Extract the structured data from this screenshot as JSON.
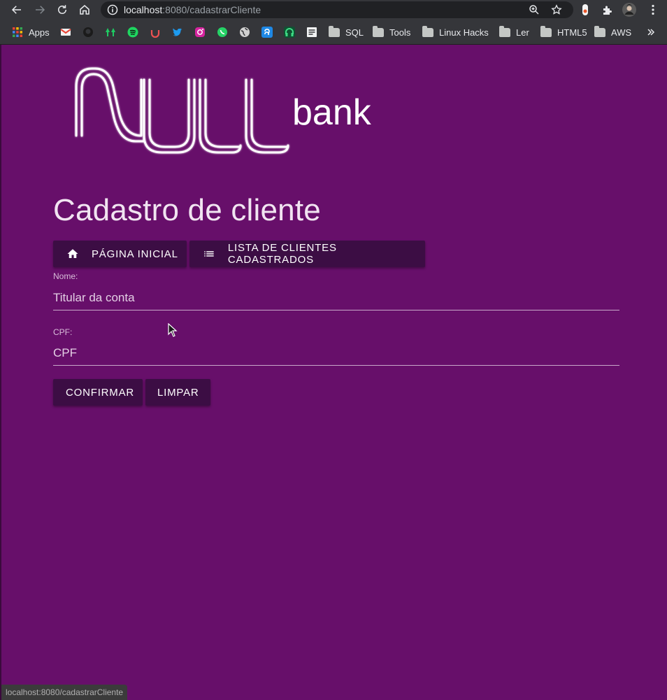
{
  "browser": {
    "url_host": "localhost",
    "url_rest": ":8080/cadastrarCliente",
    "bookmarks": {
      "apps": "Apps",
      "sql": "SQL",
      "tools": "Tools",
      "linux_hacks": "Linux Hacks",
      "ler": "Ler",
      "html5": "HTML5",
      "aws": "AWS"
    },
    "status_url": "localhost:8080/cadastrarCliente"
  },
  "logo": {
    "word": "NULL",
    "suffix": "bank"
  },
  "header": {
    "title": "Cadastro de cliente"
  },
  "nav": {
    "home_label": "Página inicial",
    "list_label": "Lista de clientes cadastrados"
  },
  "form": {
    "name_label": "Nome:",
    "name_placeholder": "Titular da conta",
    "name_value": "",
    "cpf_label": "CPF:",
    "cpf_placeholder": "CPF",
    "cpf_value": "",
    "confirm_label": "Confirmar",
    "clear_label": "Limpar"
  },
  "colors": {
    "page_background": "#670f6a",
    "button_background": "#3c0d44",
    "chrome_background": "#35363a"
  }
}
